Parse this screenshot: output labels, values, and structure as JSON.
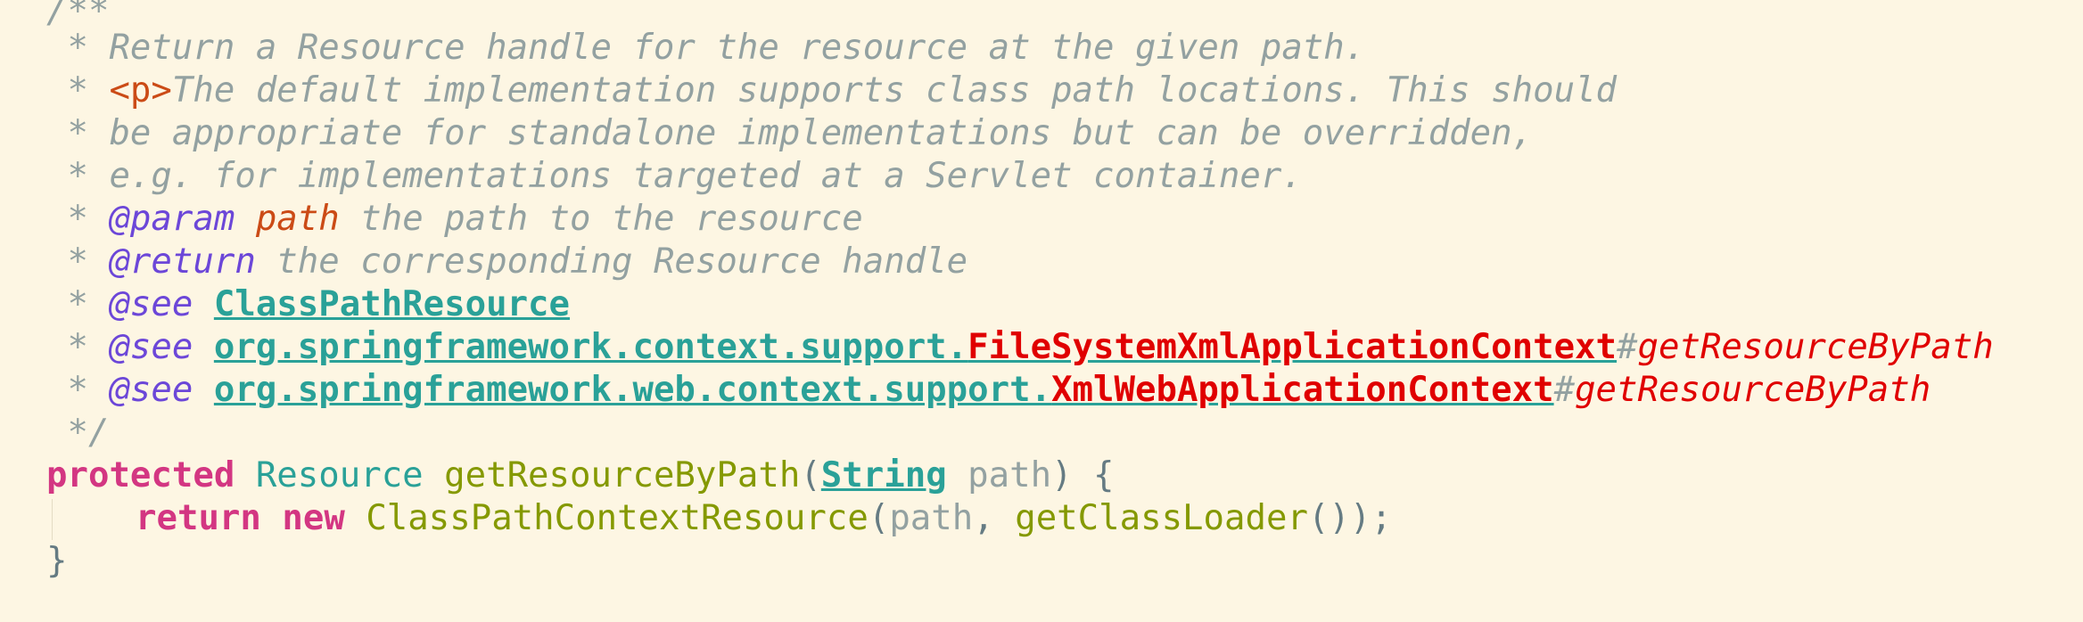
{
  "doc": {
    "open": "/**",
    "star": " * ",
    "close": " */",
    "line1": "Return a Resource handle for the resource at the given path.",
    "p_tag": "<p>",
    "line2_rest": "The default implementation supports class path locations. This should",
    "line3": "be appropriate for standalone implementations but can be overridden,",
    "line4": "e.g. for implementations targeted at a Servlet container.",
    "param_tag": "@param",
    "param_name": "path",
    "param_desc": " the path to the resource",
    "return_tag": "@return",
    "return_desc": " the corresponding Resource handle",
    "see_tag": "@see",
    "see1": "ClassPathResource",
    "see2_pkg": "org.springframework.context.support.",
    "see2_class": "FileSystemXmlApplicationContext",
    "see2_hash": "#",
    "see2_member": "getResourceByPath",
    "see3_pkg": "org.springframework.web.context.support.",
    "see3_class": "XmlWebApplicationContext",
    "see3_hash": "#",
    "see3_member": "getResourceByPath"
  },
  "code": {
    "modifier": "protected",
    "return_type": "Resource",
    "method_name": "getResourceByPath",
    "paren_open": "(",
    "param_type": "String",
    "param_name": "path",
    "sig_close": ") {",
    "kw_return": "return",
    "kw_new": "new",
    "ctor": "ClassPathContextResource",
    "arg1": "path",
    "comma": ", ",
    "call": "getClassLoader",
    "call_close": "());",
    "close_brace": "}"
  }
}
